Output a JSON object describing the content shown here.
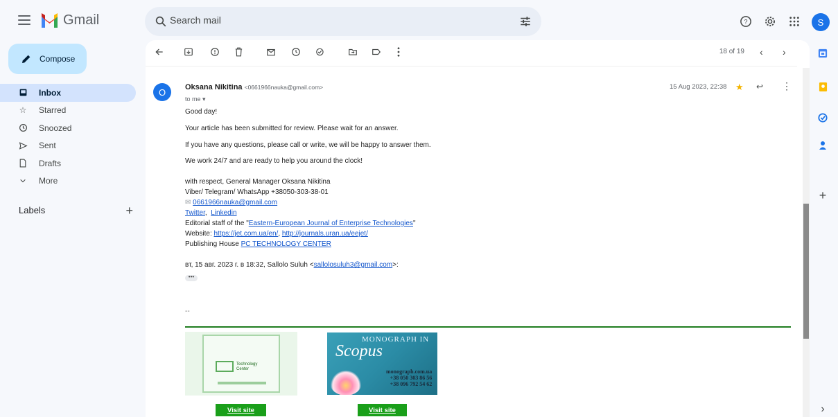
{
  "app": {
    "name": "Gmail",
    "brand_color": "#ea4335"
  },
  "search": {
    "placeholder": "Search mail"
  },
  "account": {
    "avatar_initial": "S"
  },
  "compose": {
    "label": "Compose"
  },
  "nav": {
    "items": [
      {
        "label": "Inbox",
        "icon": "inbox-icon",
        "active": true
      },
      {
        "label": "Starred",
        "icon": "star-outline-icon"
      },
      {
        "label": "Snoozed",
        "icon": "clock-icon"
      },
      {
        "label": "Sent",
        "icon": "send-icon"
      },
      {
        "label": "Drafts",
        "icon": "draft-icon"
      },
      {
        "label": "More",
        "icon": "chevron-down-icon"
      }
    ],
    "labels_heading": "Labels"
  },
  "toolbar": {
    "count": "18 of 19"
  },
  "message": {
    "sender_initial": "O",
    "sender_name": "Oksana Nikitina",
    "sender_email": "<0661966nauka@gmail.com>",
    "to": "to me",
    "date": "15 Aug 2023, 22:38",
    "greeting": "Good day!",
    "line1": "Your article has been submitted for review. Please wait for an answer.",
    "line2": "If you have any questions, please call or write, we will be happy to answer them.",
    "line3": "We work 24/7 and are ready to help you around the clock!",
    "sig1": "with respect, General Manager Oksana Nikitina",
    "sig2": "Viber/ Telegram/ WhatsApp  +38050-303-38-01",
    "sig_email": "0661966nauka@gmail.com",
    "twitter": "Twitter",
    "linkedin": "Linkedin",
    "editorial_prefix": "Editorial staff of the \"",
    "journal": "Eastern-European  Journal of Enterprise Technologies",
    "editorial_suffix": "\"",
    "website_prefix": "Website: ",
    "website1": "https://jet.com.ua/en/",
    "website2": "http://journals.uran.ua/eejet/",
    "publisher_prefix": "Publishing House ",
    "publisher": "PC TECHNOLOGY CENTER",
    "quote_prefix": "вт, 15 авг. 2023 г. в 18:32, Sallolo Suluh <",
    "quote_email": "sallolosuluh3@gmail.com",
    "quote_suffix": ">:",
    "dash": "--"
  },
  "banners": {
    "left_label_1": "Technology",
    "left_label_2": "Center",
    "right_title": "MONOGRAPH IN",
    "right_script": "Scopus",
    "right_site": "monograph.com.ua",
    "right_phone1": "+38 050 303 86 56",
    "right_phone2": "+38 096 792 54 62",
    "visit_label": "Visit site"
  }
}
